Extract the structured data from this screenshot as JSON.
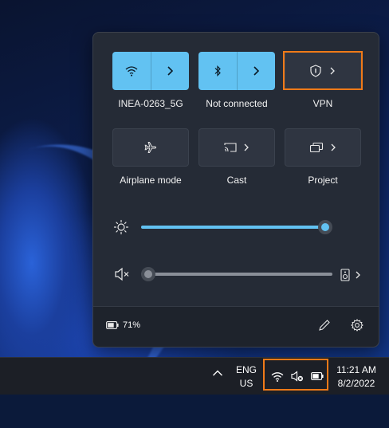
{
  "quick_settings": {
    "tiles": {
      "wifi": {
        "label": "INEA-0263_5G"
      },
      "bluetooth": {
        "label": "Not connected"
      },
      "vpn": {
        "label": "VPN"
      },
      "airplane": {
        "label": "Airplane mode"
      },
      "cast": {
        "label": "Cast"
      },
      "project": {
        "label": "Project"
      }
    },
    "brightness": {
      "level": 1.0
    },
    "volume": {
      "level": 0.0,
      "muted": true
    },
    "battery_percent": "71%"
  },
  "taskbar": {
    "language_top": "ENG",
    "language_bottom": "US",
    "time": "11:21 AM",
    "date": "8/2/2022"
  },
  "colors": {
    "accent": "#62c2f2",
    "highlight": "#f07a18",
    "panel": "#252b36"
  }
}
